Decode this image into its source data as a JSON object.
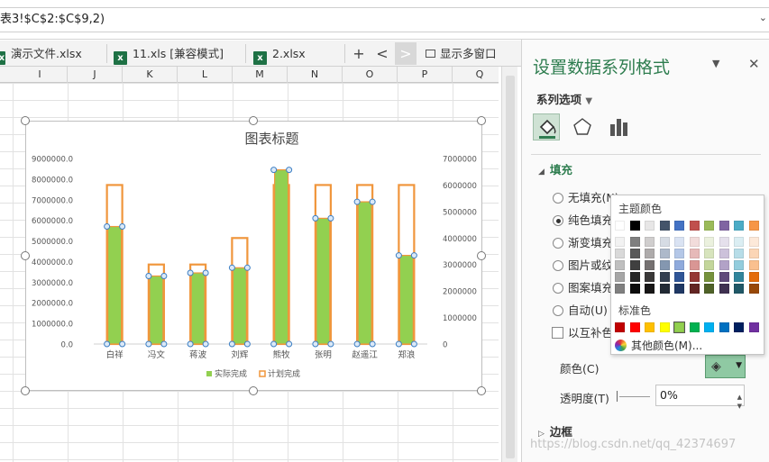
{
  "formula_bar": {
    "text": "表3!$C$2:$C$9,2)"
  },
  "file_tabs": [
    {
      "name": "演示文件.xlsx",
      "icon": "excel-file-icon"
    },
    {
      "name": "11.xls [兼容模式]",
      "icon": "excel-file-icon"
    },
    {
      "name": "2.xlsx",
      "icon": "excel-file-icon"
    }
  ],
  "tab_controls": {
    "add": "+",
    "prev": "<",
    "next": ">",
    "multi_window": "显示多窗口"
  },
  "columns": [
    "I",
    "J",
    "K",
    "L",
    "M",
    "N",
    "O",
    "P",
    "Q"
  ],
  "chart_data": {
    "type": "bar",
    "title": "图表标题",
    "categories": [
      "白祥",
      "冯文",
      "蒋波",
      "刘辉",
      "熊牧",
      "张明",
      "赵遥江",
      "郑浪"
    ],
    "series": [
      {
        "name": "实际完成",
        "axis": "left",
        "color": "#92d050",
        "values": [
          5700000,
          3300000,
          3450000,
          3700000,
          8450000,
          6100000,
          6900000,
          4300000
        ]
      },
      {
        "name": "计划完成",
        "axis": "right",
        "color": "#f0963c",
        "values": [
          6000000,
          3000000,
          3000000,
          4000000,
          6000000,
          6000000,
          6000000,
          6000000
        ]
      }
    ],
    "left_axis": {
      "min": 0,
      "max": 9000000,
      "ticks": [
        "9000000.0",
        "8000000.0",
        "7000000.0",
        "6000000.0",
        "5000000.0",
        "4000000.0",
        "3000000.0",
        "2000000.0",
        "1000000.0",
        "0.0"
      ]
    },
    "right_axis": {
      "min": 0,
      "max": 7000000,
      "ticks": [
        "7000000",
        "6000000",
        "5000000",
        "4000000",
        "3000000",
        "2000000",
        "1000000",
        "0"
      ]
    },
    "legend": "bottom",
    "gridlines": false
  },
  "pane": {
    "title": "设置数据系列格式",
    "series_options": "系列选项",
    "fill_section": "填充",
    "fill_options": [
      "无填充(N)",
      "纯色填充",
      "渐变填充",
      "图片或纹",
      "图案填充",
      "自动(U)"
    ],
    "selected_fill": 1,
    "invert_label": "以互补色",
    "color_label": "颜色(C)",
    "transparency_label": "透明度(T)",
    "transparency_value": "0%",
    "border_section": "边框",
    "close": "✕",
    "dropdown": "▼"
  },
  "color_popup": {
    "theme_title": "主题颜色",
    "standard_title": "标准色",
    "more_colors": "其他颜色(M)...",
    "theme_top": [
      "#ffffff",
      "#000000",
      "#e7e6e6",
      "#44546a",
      "#4472c4",
      "#c0504d",
      "#9bbb59",
      "#8064a2",
      "#4bacc6",
      "#f79646"
    ],
    "theme_shades": [
      [
        "#f2f2f2",
        "#7f7f7f",
        "#d0cece",
        "#d6dce4",
        "#dae3f3",
        "#f2dcdb",
        "#ebf1de",
        "#e5e0ec",
        "#dbeef3",
        "#fde9d9"
      ],
      [
        "#d9d9d9",
        "#595959",
        "#aeabab",
        "#adb9ca",
        "#b4c7e7",
        "#e6b9b8",
        "#d7e4bd",
        "#ccc1da",
        "#b7dde8",
        "#fbd5b5"
      ],
      [
        "#bfbfbf",
        "#404040",
        "#757171",
        "#8497b0",
        "#8faadc",
        "#d99694",
        "#c3d69b",
        "#b2a2c7",
        "#93cddd",
        "#fac08f"
      ],
      [
        "#a6a6a6",
        "#262626",
        "#3a3838",
        "#333f50",
        "#2f5597",
        "#953735",
        "#76923c",
        "#5f497a",
        "#31859c",
        "#e46c0a"
      ],
      [
        "#808080",
        "#0d0d0d",
        "#171616",
        "#222a35",
        "#1f3864",
        "#632523",
        "#4f6228",
        "#3f3151",
        "#205867",
        "#984807"
      ]
    ],
    "standard": [
      "#c00000",
      "#ff0000",
      "#ffc000",
      "#ffff00",
      "#92d050",
      "#00b050",
      "#00b0f0",
      "#0070c0",
      "#002060",
      "#7030a0"
    ],
    "selected_standard": 4
  },
  "watermark": "https://blog.csdn.net/qq_42374697"
}
